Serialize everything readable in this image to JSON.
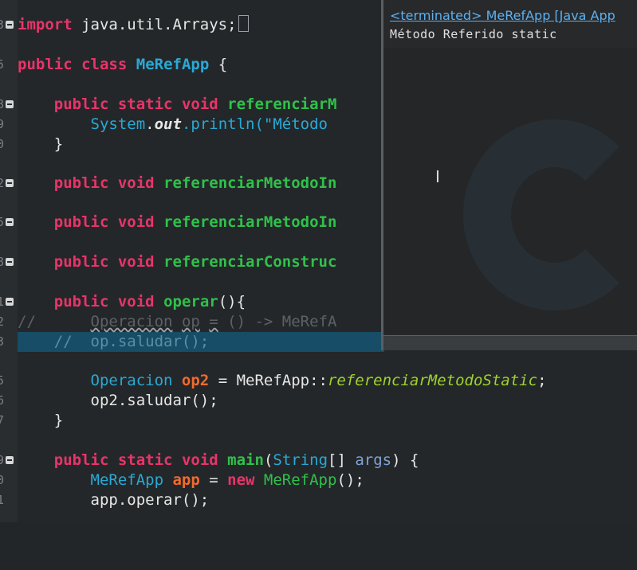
{
  "editor": {
    "lines": {
      "l1": {
        "num": "3",
        "import": "import",
        "rest": " java.util.Arrays;"
      },
      "l2": {
        "num": "5",
        "pub": "public",
        "cls_kw": "class",
        "name": "MeRefApp",
        "rest": " {"
      },
      "l3": {
        "num": "8",
        "pub": "public",
        "st": "static",
        "vd": "void",
        "meth": "referenciarM"
      },
      "l4": {
        "num": "9",
        "sys": "System",
        "dot1": ".",
        "out": "out",
        "rest": ".println(\"Método "
      },
      "l5": {
        "num": "0",
        "rest": "}"
      },
      "l6": {
        "num": "2",
        "pub": "public",
        "vd": "void",
        "meth": "referenciarMetodoIn"
      },
      "l7": {
        "num": "5",
        "pub": "public",
        "vd": "void",
        "meth": "referenciarMetodoIn"
      },
      "l8": {
        "num": "8",
        "pub": "public",
        "vd": "void",
        "meth": "referenciarConstruc"
      },
      "l9": {
        "num": "1",
        "pub": "public",
        "vd": "void",
        "meth": "operar",
        "rest": "(){"
      },
      "l10": {
        "num": "2",
        "slashes": "//",
        "pad": "      ",
        "a": "Operacion",
        "b": " ",
        "c": "op",
        "d": " ",
        "e": "=",
        "f": " () -> MeRefA"
      },
      "l11": {
        "num": "3",
        "text": "//  op.saludar();"
      },
      "l12": {
        "num": "5",
        "type": "Operacion",
        "var": "op2",
        "eq": " = MeRefApp::",
        "ref": "referenciarMetodoStatic",
        "end": ";"
      },
      "l13": {
        "num": "6",
        "text": "op2.saludar();"
      },
      "l14": {
        "num": "7",
        "rest": "}"
      },
      "l15": {
        "num": "9",
        "pub": "public",
        "st": "static",
        "vd": "void",
        "main": "main",
        "p1": "(",
        "strtype": "String",
        "p2": "[] ",
        "args": "args",
        "p3": ") {"
      },
      "l16": {
        "num": "0",
        "cls": "MeRefApp",
        "var": "app",
        "eq": " = ",
        "nw": "new",
        "ctor": "MeRefApp",
        "end": "();"
      },
      "l17": {
        "num": "1",
        "text": "app.operar();"
      }
    }
  },
  "console": {
    "header": "<terminated> MeRefApp [Java App",
    "output": "Método Referido static"
  }
}
